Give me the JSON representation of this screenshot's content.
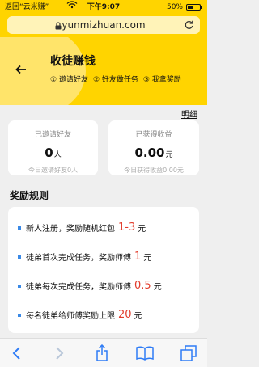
{
  "status_bar": {
    "back_app": "返回“云米赚”",
    "signal": "",
    "time": "下午9:07",
    "battery": "50%",
    "battery_level": 0.5
  },
  "browser": {
    "url": "yunmizhuan.com"
  },
  "header": {
    "title": "收徒赚钱",
    "steps": [
      "① 邀请好友",
      "② 好友做任务",
      "③ 我拿奖励"
    ]
  },
  "details_link": "明细",
  "stats": [
    {
      "label": "已邀请好友",
      "value": "0",
      "unit": "人",
      "sub": "今日邀请好友0人"
    },
    {
      "label": "已获得收益",
      "value": "0.00",
      "unit": "元",
      "sub": "今日获得收益0.00元"
    }
  ],
  "rules": {
    "title": "奖励规则",
    "items": [
      {
        "text": "新人注册，奖励随机红包",
        "highlight": "1-3",
        "unit": "元"
      },
      {
        "text": "徒弟首次完成任务，奖励师傅",
        "highlight": "1",
        "unit": "元"
      },
      {
        "text": "徒弟每次完成任务，奖励师傅",
        "highlight": "0.5",
        "unit": "元"
      },
      {
        "text": "每名徒弟给师傅奖励上限",
        "highlight": "20",
        "unit": "元"
      }
    ]
  },
  "toolbar": {
    "items": [
      "back-icon",
      "forward-icon",
      "share-icon",
      "bookmarks-icon",
      "tabs-icon"
    ]
  },
  "colors": {
    "brand_yellow": "#ffd400",
    "highlight_red": "#e23c2c",
    "bullet_blue": "#3a89e6",
    "ios_blue": "#2f7cf6"
  }
}
